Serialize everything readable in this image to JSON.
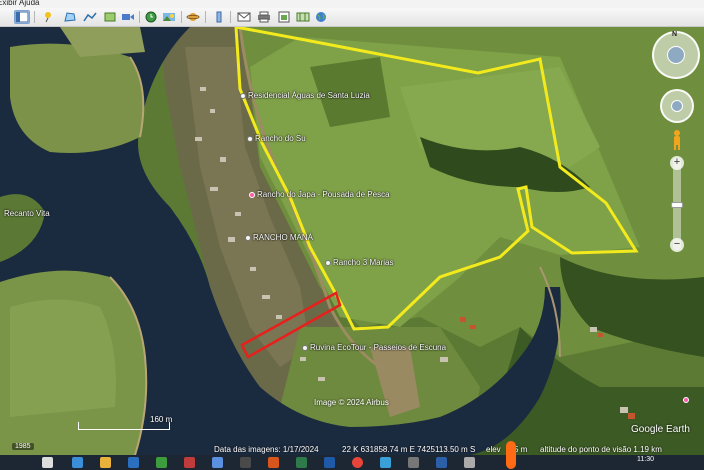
{
  "menu": {
    "items": [
      "Exibir",
      "Ajuda"
    ]
  },
  "toolbar": {
    "buttons": [
      "sidebar-toggle",
      "placemark",
      "polygon",
      "path",
      "image-overlay",
      "record-tour",
      "historical-imagery",
      "sunlight",
      "planets",
      "ruler",
      "email",
      "print",
      "save-image",
      "view-in-maps"
    ]
  },
  "map": {
    "places": {
      "residencial": "Residencial Águas de Santa Luzia",
      "rancho_do_su": "Rancho do Su",
      "rancho_japa": "Rancho do Japa - Pousada de Pesca",
      "rancho_mana": "RANCHO MANÁ",
      "rancho_3_marias": "Rancho 3 Marias",
      "ruvina": "Ruvina EcoTour - Passeios de Escuna",
      "recanto": "Recanto Vita"
    },
    "copyright": "Image © 2024 Airbus",
    "scale_label": "160 m",
    "year": "1985",
    "google_logo": "Google Earth",
    "north_label": "N",
    "zoom_in": "+",
    "zoom_out": "−"
  },
  "status": {
    "image_date": "Data das imagens: 1/17/2024",
    "coords": "22 K 631858.74 m E 7425113.50 m S",
    "elevation": "elev",
    "elevation_value": "5 m",
    "eye_altitude": "altitude do ponto de visão   1.19 km"
  },
  "taskbar": {
    "time": "11:30"
  },
  "colors": {
    "boundary": "#f2ea1d",
    "parcel": "#e8201c",
    "water": "#1b2b3f",
    "pasture": "#6a8a3c"
  }
}
